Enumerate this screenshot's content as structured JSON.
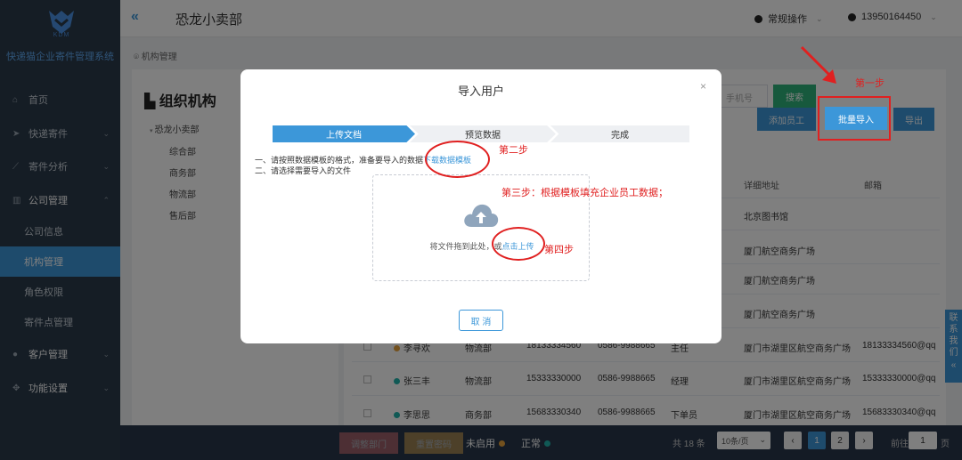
{
  "sidebar": {
    "logo_text": "KDM",
    "brand": "快递猫企业寄件管理系统",
    "items": [
      {
        "label": "首页",
        "icon": "home-icon"
      },
      {
        "label": "快递寄件",
        "icon": "send-icon"
      },
      {
        "label": "寄件分析",
        "icon": "chart-icon"
      },
      {
        "label": "公司管理",
        "icon": "building-icon"
      },
      {
        "label": "客户管理",
        "icon": "person-icon"
      },
      {
        "label": "功能设置",
        "icon": "settings-icon"
      }
    ],
    "subitems": [
      {
        "label": "公司信息"
      },
      {
        "label": "机构管理"
      },
      {
        "label": "角色权限"
      },
      {
        "label": "寄件点管理"
      }
    ]
  },
  "header": {
    "collapse": "«",
    "title": "恐龙小卖部",
    "operation": "常规操作",
    "user": "13950164450"
  },
  "breadcrumb": "机构管理",
  "org": {
    "title": "组织机构",
    "root": "恐龙小卖部",
    "children": [
      "综合部",
      "商务部",
      "物流部",
      "售后部"
    ]
  },
  "toolbar": {
    "search_placeholder": "手机号",
    "search": "搜索",
    "add": "添加员工",
    "import": "批量导入",
    "export": "导出"
  },
  "table": {
    "headers": {
      "address": "详细地址",
      "email": "邮箱"
    },
    "rows": [
      {
        "address": "北京图书馆"
      },
      {
        "address": "厦门航空商务广场"
      },
      {
        "address": "厦门航空商务广场"
      },
      {
        "address": "厦门航空商务广场"
      },
      {
        "name": "李寻欢",
        "dept": "物流部",
        "phone": "18133334560",
        "tel": "0586-9988665",
        "role": "主任",
        "address": "厦门市湖里区航空商务广场",
        "email": "18133334560@qq"
      },
      {
        "name": "张三丰",
        "dept": "物流部",
        "phone": "15333330000",
        "tel": "0586-9988665",
        "role": "经理",
        "address": "厦门市湖里区航空商务广场",
        "email": "15333330000@qq"
      },
      {
        "name": "李思思",
        "dept": "商务部",
        "phone": "15683330340",
        "tel": "0586-9988665",
        "role": "下单员",
        "address": "厦门市湖里区航空商务广场",
        "email": "15683330340@qq"
      }
    ]
  },
  "side_tab": "联系我们",
  "footer": {
    "btn1": "调整部门",
    "btn2": "重置密码",
    "disabled": "未启用",
    "normal": "正常",
    "total": "共 18 条",
    "page_size": "10条/页",
    "pages": [
      "1",
      "2"
    ],
    "goto": "前往",
    "page_input": "1",
    "page_unit": "页"
  },
  "modal": {
    "title": "导入用户",
    "close": "×",
    "steps": [
      "上传文档",
      "预览数据",
      "完成"
    ],
    "instr1_pre": "一、请按照数据模板的格式，准备要导入的数据",
    "instr1_link": "下载数据模板",
    "instr2": "二、请选择需要导入的文件",
    "drop_text": "将文件拖到此处，或",
    "drop_link": "点击上传",
    "cancel": "取 消"
  },
  "annotations": {
    "step1": "第一步",
    "step2": "第二步",
    "step3": "第三步：根据模板填充企业员工数据；",
    "step4": "第四步"
  },
  "colors": {
    "accent": "#3c97d9",
    "sidebar_bg": "#2b3a4a",
    "annotation": "#e02020",
    "search_btn": "#2fb37a"
  }
}
